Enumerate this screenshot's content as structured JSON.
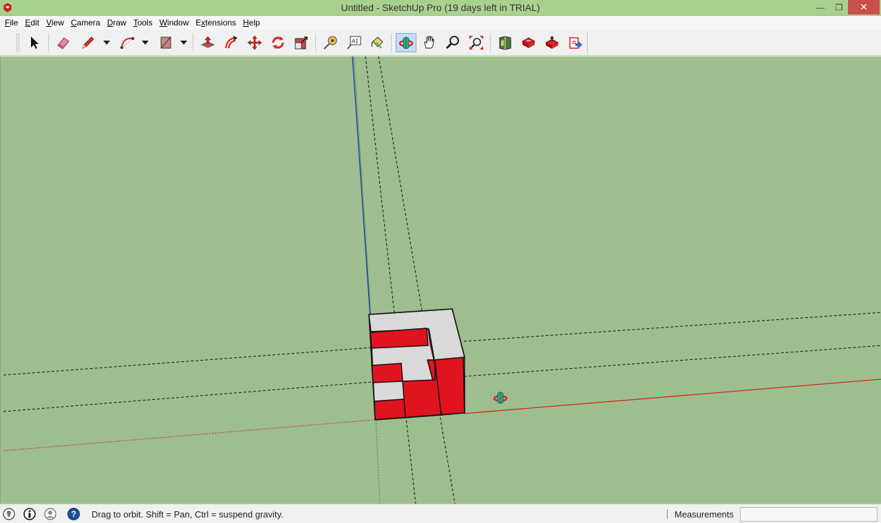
{
  "window": {
    "title": "Untitled - SketchUp Pro (19 days left in TRIAL)",
    "minimize_glyph": "—",
    "restore_glyph": "❐",
    "close_glyph": "✕"
  },
  "menu": [
    {
      "label": "File",
      "accel": "F",
      "rest": "ile"
    },
    {
      "label": "Edit",
      "accel": "E",
      "rest": "dit"
    },
    {
      "label": "View",
      "accel": "V",
      "rest": "iew"
    },
    {
      "label": "Camera",
      "accel": "C",
      "rest": "amera"
    },
    {
      "label": "Draw",
      "accel": "D",
      "rest": "raw"
    },
    {
      "label": "Tools",
      "accel": "T",
      "rest": "ools"
    },
    {
      "label": "Window",
      "accel": "W",
      "rest": "indow"
    },
    {
      "label": "Extensions",
      "accel": "x",
      "pre": "E",
      "rest": "tensions"
    },
    {
      "label": "Help",
      "accel": "H",
      "rest": "elp"
    }
  ],
  "toolbar": {
    "tools": [
      {
        "id": "select",
        "icon": "arrow-cursor-icon"
      },
      {
        "id": "eraser",
        "icon": "eraser-icon"
      },
      {
        "id": "line",
        "icon": "pencil-icon"
      },
      {
        "id": "arc",
        "icon": "arc-icon"
      },
      {
        "id": "rectangle",
        "icon": "rectangle-icon"
      },
      {
        "id": "push-pull",
        "icon": "push-pull-icon"
      },
      {
        "id": "offset",
        "icon": "offset-icon"
      },
      {
        "id": "move",
        "icon": "move-icon"
      },
      {
        "id": "rotate",
        "icon": "rotate-icon"
      },
      {
        "id": "scale",
        "icon": "scale-icon"
      },
      {
        "id": "tape-measure",
        "icon": "tape-measure-icon"
      },
      {
        "id": "text",
        "icon": "text-icon",
        "glyph": "A1"
      },
      {
        "id": "paint-bucket",
        "icon": "paint-bucket-icon"
      },
      {
        "id": "orbit",
        "icon": "orbit-icon",
        "active": true
      },
      {
        "id": "pan",
        "icon": "hand-icon"
      },
      {
        "id": "zoom",
        "icon": "magnifier-icon"
      },
      {
        "id": "zoom-extents",
        "icon": "zoom-extents-icon"
      },
      {
        "id": "warehouse",
        "icon": "warehouse-icon"
      },
      {
        "id": "get-models",
        "icon": "get-models-icon"
      },
      {
        "id": "share-model",
        "icon": "share-model-icon"
      },
      {
        "id": "extension-warehouse",
        "icon": "extension-warehouse-icon"
      }
    ]
  },
  "status": {
    "message": "Drag to orbit. Shift = Pan, Ctrl = suspend gravity.",
    "measurements_label": "Measurements",
    "measurements_value": "",
    "help_glyph": "?"
  },
  "colors": {
    "sky_ground": "#9dbe8e",
    "title_bar": "#a9d18e",
    "face_red": "#e0141e",
    "face_white": "#d9d9d9",
    "axis_red": "#d42020",
    "axis_green": "#20a020",
    "axis_blue": "#2020c0"
  }
}
